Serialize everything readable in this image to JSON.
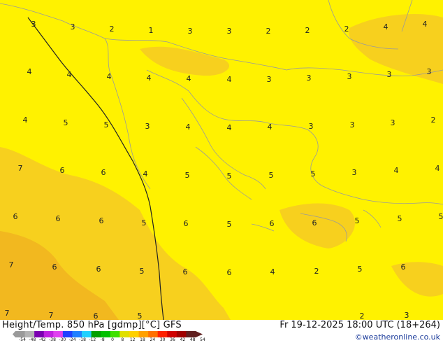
{
  "footer": {
    "title": "Height/Temp. 850 hPa [gdmp][°C] GFS",
    "datetime": "Fr 19-12-2025 18:00 UTC (18+264)",
    "credit": "©weatheronline.co.uk"
  },
  "colorbar": {
    "ticks": [
      "-54",
      "-48",
      "-42",
      "-38",
      "-30",
      "-24",
      "-18",
      "-12",
      "-8",
      "0",
      "8",
      "12",
      "18",
      "24",
      "30",
      "36",
      "42",
      "48",
      "54"
    ],
    "colors": [
      "#9a9a9a",
      "#b3b3b3",
      "#7a00b0",
      "#c020e0",
      "#e040f0",
      "#2040ff",
      "#2080ff",
      "#20d0ff",
      "#00a000",
      "#00c000",
      "#40e000",
      "#e0e000",
      "#ffd000",
      "#ffa000",
      "#ff7000",
      "#ff2000",
      "#d00000",
      "#a00000",
      "#602020"
    ]
  },
  "map_colors": {
    "base": "#fff200",
    "warm": "#f7d01e",
    "hot": "#f2b81f",
    "border": "#9a9a9a",
    "front": "#222222"
  },
  "temperature_labels": [
    {
      "id": "t1",
      "v": "3"
    },
    {
      "id": "t2",
      "v": "3"
    },
    {
      "id": "t3",
      "v": "2"
    },
    {
      "id": "t4",
      "v": "1"
    },
    {
      "id": "t5",
      "v": "3"
    },
    {
      "id": "t6",
      "v": "3"
    },
    {
      "id": "t7",
      "v": "2"
    },
    {
      "id": "t8",
      "v": "2"
    },
    {
      "id": "t9",
      "v": "2"
    },
    {
      "id": "t10",
      "v": "4"
    },
    {
      "id": "t11",
      "v": "4"
    },
    {
      "id": "t12",
      "v": "4"
    },
    {
      "id": "t13",
      "v": "4"
    },
    {
      "id": "t14",
      "v": "4"
    },
    {
      "id": "t15",
      "v": "4"
    },
    {
      "id": "t16",
      "v": "4"
    },
    {
      "id": "t17",
      "v": "4"
    },
    {
      "id": "t18",
      "v": "3"
    },
    {
      "id": "t19",
      "v": "3"
    },
    {
      "id": "t20",
      "v": "3"
    },
    {
      "id": "t21",
      "v": "3"
    },
    {
      "id": "t22",
      "v": "3"
    },
    {
      "id": "t23",
      "v": "4"
    },
    {
      "id": "t24",
      "v": "5"
    },
    {
      "id": "t25",
      "v": "5"
    },
    {
      "id": "t26",
      "v": "3"
    },
    {
      "id": "t27",
      "v": "4"
    },
    {
      "id": "t28",
      "v": "4"
    },
    {
      "id": "t29",
      "v": "4"
    },
    {
      "id": "t30",
      "v": "3"
    },
    {
      "id": "t31",
      "v": "3"
    },
    {
      "id": "t32",
      "v": "3"
    },
    {
      "id": "t33",
      "v": "2"
    },
    {
      "id": "t34",
      "v": "7"
    },
    {
      "id": "t35",
      "v": "6"
    },
    {
      "id": "t36",
      "v": "6"
    },
    {
      "id": "t37",
      "v": "4"
    },
    {
      "id": "t38",
      "v": "5"
    },
    {
      "id": "t39",
      "v": "5"
    },
    {
      "id": "t40",
      "v": "5"
    },
    {
      "id": "t41",
      "v": "5"
    },
    {
      "id": "t42",
      "v": "3"
    },
    {
      "id": "t43",
      "v": "4"
    },
    {
      "id": "t44",
      "v": "4"
    },
    {
      "id": "t45",
      "v": "6"
    },
    {
      "id": "t46",
      "v": "6"
    },
    {
      "id": "t47",
      "v": "6"
    },
    {
      "id": "t48",
      "v": "5"
    },
    {
      "id": "t49",
      "v": "6"
    },
    {
      "id": "t50",
      "v": "5"
    },
    {
      "id": "t51",
      "v": "6"
    },
    {
      "id": "t52",
      "v": "6"
    },
    {
      "id": "t53",
      "v": "5"
    },
    {
      "id": "t54",
      "v": "5"
    },
    {
      "id": "t55",
      "v": "5"
    },
    {
      "id": "t56",
      "v": "7"
    },
    {
      "id": "t57",
      "v": "6"
    },
    {
      "id": "t58",
      "v": "6"
    },
    {
      "id": "t59",
      "v": "5"
    },
    {
      "id": "t60",
      "v": "6"
    },
    {
      "id": "t61",
      "v": "6"
    },
    {
      "id": "t62",
      "v": "4"
    },
    {
      "id": "t63",
      "v": "2"
    },
    {
      "id": "t64",
      "v": "5"
    },
    {
      "id": "t65",
      "v": "6"
    },
    {
      "id": "t66",
      "v": "7"
    },
    {
      "id": "t67",
      "v": "7"
    },
    {
      "id": "t68",
      "v": "6"
    },
    {
      "id": "t69",
      "v": "5"
    },
    {
      "id": "t70",
      "v": "2"
    },
    {
      "id": "t71",
      "v": "3"
    }
  ]
}
